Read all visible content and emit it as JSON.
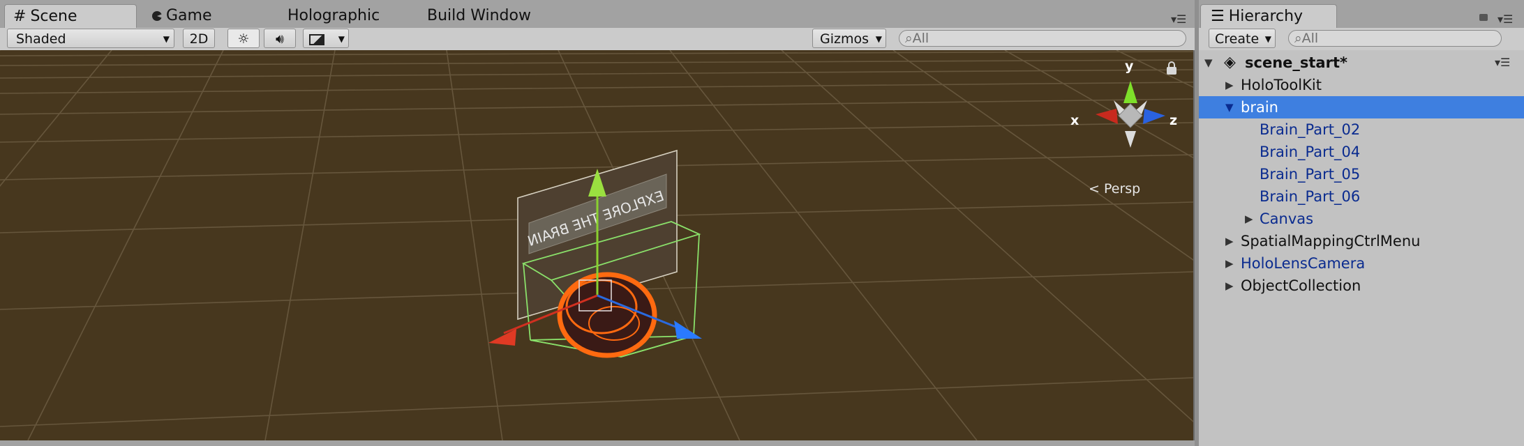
{
  "scene_tabs": [
    {
      "label": "Scene",
      "icon": "grid-icon",
      "active": true
    },
    {
      "label": "Game",
      "icon": "pacman-icon",
      "active": false
    },
    {
      "label": "Holographic",
      "active": false
    },
    {
      "label": "Build Window",
      "active": false
    }
  ],
  "scene_toolbar": {
    "draw_mode": "Shaded",
    "mode_2d": "2D",
    "gizmos": "Gizmos",
    "search_placeholder": "All"
  },
  "viewport": {
    "axis_y": "y",
    "axis_x": "x",
    "axis_z": "z",
    "projection": "Persp",
    "canvas_text": "EXPLORE THE BRAIN"
  },
  "hierarchy": {
    "tab_label": "Hierarchy",
    "create_label": "Create",
    "search_placeholder": "All",
    "scene_name": "scene_start*",
    "items": [
      {
        "label": "HoloToolKit",
        "expander": "collapsed",
        "color": "#111111"
      },
      {
        "label": "brain",
        "expander": "expanded",
        "selected": true,
        "color": "#ffffff"
      },
      {
        "label": "Brain_Part_02",
        "color": "#0a2b8f"
      },
      {
        "label": "Brain_Part_04",
        "color": "#0a2b8f"
      },
      {
        "label": "Brain_Part_05",
        "color": "#0a2b8f"
      },
      {
        "label": "Brain_Part_06",
        "color": "#0a2b8f"
      },
      {
        "label": "Canvas",
        "expander": "collapsed",
        "color": "#0a2b8f"
      },
      {
        "label": "SpatialMappingCtrlMenu",
        "expander": "collapsed",
        "color": "#111111"
      },
      {
        "label": "HoloLensCamera",
        "expander": "collapsed",
        "color": "#0a2b8f"
      },
      {
        "label": "ObjectCollection",
        "expander": "collapsed",
        "color": "#111111"
      }
    ]
  },
  "colors": {
    "scene_bg": "#47371e",
    "selection": "#3e7fe0",
    "prefab_text": "#0a2b8f",
    "axis_x": "#d03020",
    "axis_y": "#8ad030",
    "axis_z": "#2a6ae0"
  }
}
